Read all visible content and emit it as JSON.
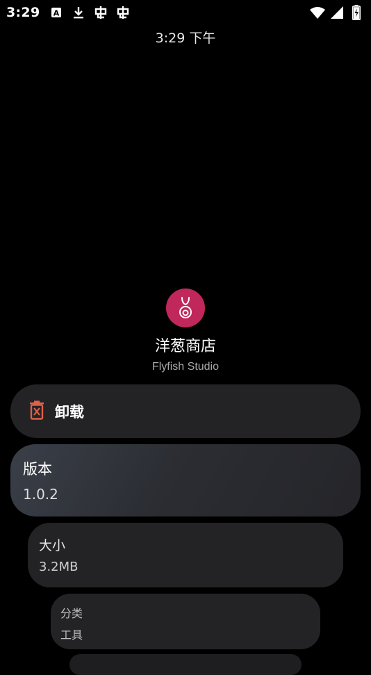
{
  "status_bar": {
    "time": "3:29",
    "icons_left": [
      "text-a-icon",
      "download-icon",
      "bug-icon",
      "bug-icon"
    ],
    "icons_right": [
      "wifi-icon",
      "signal-icon",
      "battery-charging-icon"
    ]
  },
  "clock": {
    "time": "3:29 下午"
  },
  "app": {
    "name": "洋葱商店",
    "developer": "Flyfish Studio",
    "icon_color": "#c0275a"
  },
  "actions": {
    "uninstall_label": "卸载",
    "uninstall_icon": "trash-icon",
    "uninstall_icon_color": "#e0604a"
  },
  "info": {
    "version_label": "版本",
    "version_value": "1.0.2",
    "size_label": "大小",
    "size_value": "3.2MB",
    "category_label": "分类",
    "category_value": "工具"
  }
}
